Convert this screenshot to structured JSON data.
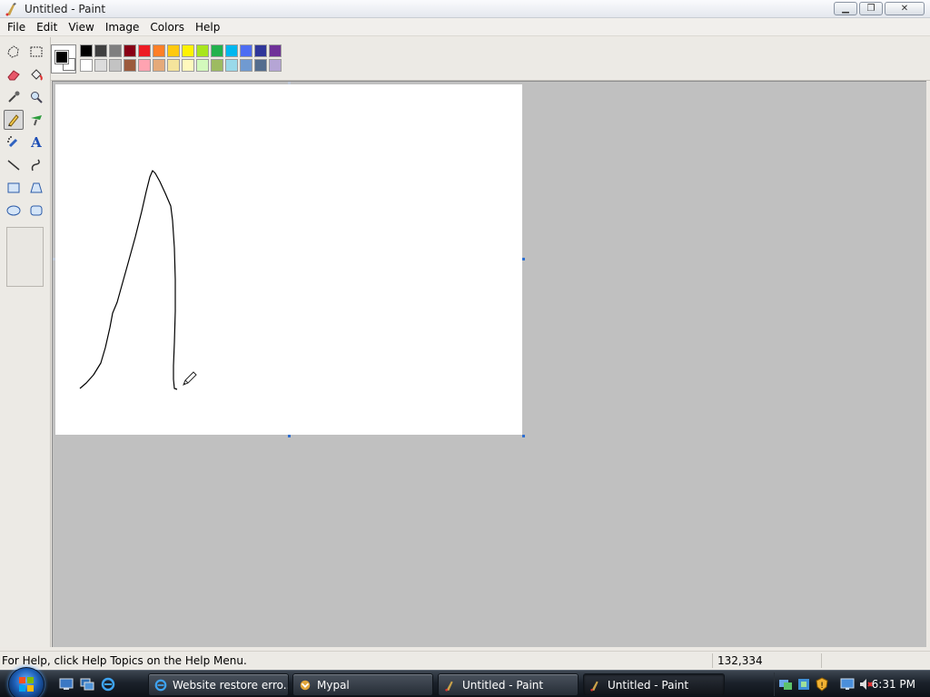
{
  "window": {
    "title": "Untitled - Paint"
  },
  "menu": [
    "File",
    "Edit",
    "View",
    "Image",
    "Colors",
    "Help"
  ],
  "tools": [
    {
      "name": "free-select-tool-button",
      "icon": "free-select-icon"
    },
    {
      "name": "rect-select-tool-button",
      "icon": "rect-select-icon"
    },
    {
      "name": "eraser-tool-button",
      "icon": "eraser-icon"
    },
    {
      "name": "fill-tool-button",
      "icon": "fill-bucket-icon"
    },
    {
      "name": "color-picker-tool-button",
      "icon": "eyedropper-icon"
    },
    {
      "name": "magnifier-tool-button",
      "icon": "magnifier-icon"
    },
    {
      "name": "pencil-tool-button",
      "icon": "pencil-icon",
      "active": true
    },
    {
      "name": "brush-tool-button",
      "icon": "brush-icon"
    },
    {
      "name": "airbrush-tool-button",
      "icon": "airbrush-icon"
    },
    {
      "name": "text-tool-button",
      "icon": "text-icon",
      "label": "A"
    },
    {
      "name": "line-tool-button",
      "icon": "line-icon"
    },
    {
      "name": "curve-tool-button",
      "icon": "curve-icon"
    },
    {
      "name": "rectangle-tool-button",
      "icon": "rectangle-icon"
    },
    {
      "name": "polygon-tool-button",
      "icon": "polygon-icon"
    },
    {
      "name": "ellipse-tool-button",
      "icon": "ellipse-icon"
    },
    {
      "name": "rounded-rect-tool-button",
      "icon": "rounded-rect-icon"
    }
  ],
  "palette": {
    "foreground": "#000000",
    "background": "#ffffff",
    "row1": [
      "#000000",
      "#3f3f3f",
      "#7f7f7f",
      "#880015",
      "#ed1c24",
      "#ff7f27",
      "#ffc90e",
      "#fff200",
      "#a8e61d",
      "#22b14c",
      "#00b7ef",
      "#4d6df3",
      "#2f3699",
      "#6f3198"
    ],
    "row2": [
      "#ffffff",
      "#dcdcdc",
      "#c3c3c3",
      "#9c5a3c",
      "#ffa3b1",
      "#e5aa7a",
      "#f5e49c",
      "#fff9bd",
      "#d3f9bc",
      "#9dbb61",
      "#99d9ea",
      "#709ad1",
      "#546d8e",
      "#b5a5d5"
    ]
  },
  "status": {
    "help_text": "For Help, click Help Topics on the Help Menu.",
    "coords": "132,334"
  },
  "taskbar": {
    "buttons": [
      {
        "label": "Website restore erro...",
        "icon": "ie-icon",
        "active": false
      },
      {
        "label": "Mypal",
        "icon": "mypal-icon",
        "active": false
      },
      {
        "label": "Untitled - Paint",
        "icon": "paint-icon",
        "active": false
      },
      {
        "label": "Untitled - Paint",
        "icon": "paint-icon",
        "active": true
      }
    ],
    "clock": "6:31 PM"
  }
}
